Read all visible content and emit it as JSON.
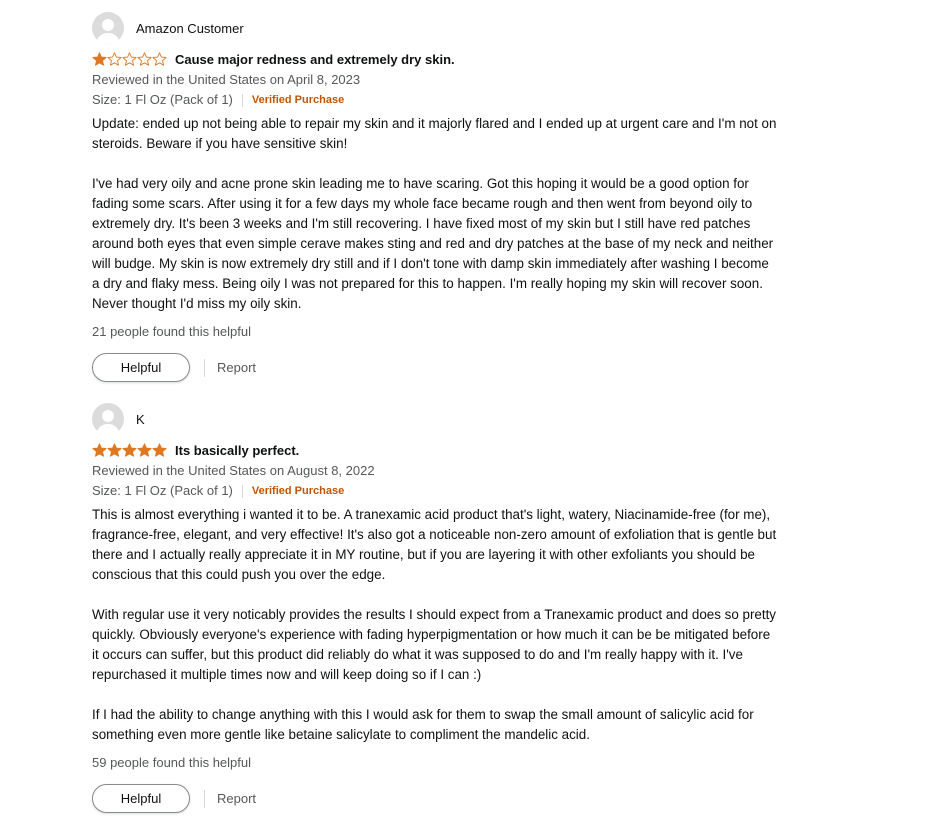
{
  "colors": {
    "star_fill": "#de7921",
    "star_empty_stroke": "#de7921",
    "verified": "#c45500",
    "text_secondary": "#565959"
  },
  "reviews": [
    {
      "author": "Amazon Customer",
      "rating": 1,
      "title": "Cause major redness and extremely dry skin.",
      "reviewed_in": "Reviewed in the United States on April 8, 2023",
      "format": "Size: 1 Fl Oz (Pack of 1)",
      "verified": "Verified Purchase",
      "body": [
        "Update: ended up not being able to repair my skin and it majorly flared and I ended up at urgent care and I'm not on steroids. Beware if you have sensitive skin!",
        "I've had very oily and acne prone skin leading me to have scaring. Got this hoping it would be a good option for fading some scars. After using it for a few days my whole face became rough and then went from beyond oily to extremely dry. It's been 3 weeks and I'm still recovering. I have fixed most of my skin but I still have red patches around both eyes that even simple cerave makes sting and red and dry patches at the base of my neck and neither will budge. My skin is now extremely dry still and if I don't tone with damp skin immediately after washing I become a dry and flaky mess. Being oily I was not prepared for this to happen. I'm really hoping my skin will recover soon. Never thought I'd miss my oily skin."
      ],
      "helpful_count": "21 people found this helpful",
      "helpful_label": "Helpful",
      "report_label": "Report"
    },
    {
      "author": "K",
      "rating": 5,
      "title": "Its basically perfect.",
      "reviewed_in": "Reviewed in the United States on August 8, 2022",
      "format": "Size: 1 Fl Oz (Pack of 1)",
      "verified": "Verified Purchase",
      "body": [
        "This is almost everything i wanted it to be. A tranexamic acid product that's light, watery, Niacinamide-free (for me), fragrance-free, elegant, and very effective! It's also got a noticeable non-zero amount of exfoliation that is gentle but there and I actually really appreciate it in MY routine, but if you are layering it with other exfoliants you should be conscious that this could push you over the edge.",
        "With regular use it very noticably provides the results I should expect from a Tranexamic product and does so pretty quickly. Obviously everyone's experience with fading hyperpigmentation or how much it can be be mitigated before it occurs can suffer, but this product did reliably do what it was supposed to do and I'm really happy with it. I've repurchased it multiple times now and will keep doing so if I can :)",
        "If I had the ability to change anything with this I would ask for them to swap the small amount of salicylic acid for something even more gentle like betaine salicylate to compliment the mandelic acid."
      ],
      "helpful_count": "59 people found this helpful",
      "helpful_label": "Helpful",
      "report_label": "Report"
    }
  ]
}
